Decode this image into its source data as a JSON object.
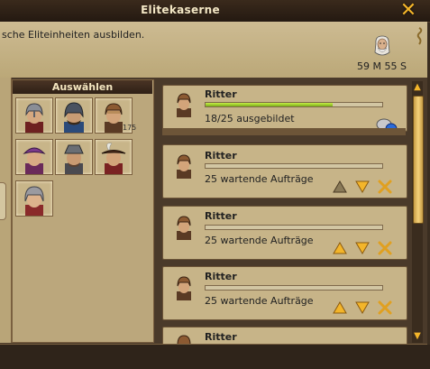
{
  "window": {
    "title": "Elitekaserne"
  },
  "description": {
    "text": "sche Eliteinheiten ausbilden.",
    "timer": "59 M 55 S"
  },
  "selection": {
    "header": "Auswählen",
    "units": [
      {
        "icon": "knight-helmet-portrait-icon"
      },
      {
        "icon": "dark-knight-portrait-icon"
      },
      {
        "icon": "ritter-portrait-icon",
        "count": "175"
      },
      {
        "icon": "purple-hat-portrait-icon"
      },
      {
        "icon": "grey-hat-portrait-icon"
      },
      {
        "icon": "feathered-hat-portrait-icon"
      },
      {
        "icon": "lady-portrait-icon"
      }
    ]
  },
  "queue": [
    {
      "name": "Ritter",
      "status": "18/25 ausgebildet",
      "progress": 0.72,
      "active": true
    },
    {
      "name": "Ritter",
      "status": "25 wartende Aufträge",
      "progress": 0
    },
    {
      "name": "Ritter",
      "status": "25 wartende Aufträge",
      "progress": 0
    },
    {
      "name": "Ritter",
      "status": "25 wartende Aufträge",
      "progress": 0
    },
    {
      "name": "Ritter",
      "status": "",
      "progress": 0
    }
  ],
  "colors": {
    "accent_gold": "#f3b52a",
    "progress_green": "#9fd12b",
    "parchment": "#c7b488"
  }
}
